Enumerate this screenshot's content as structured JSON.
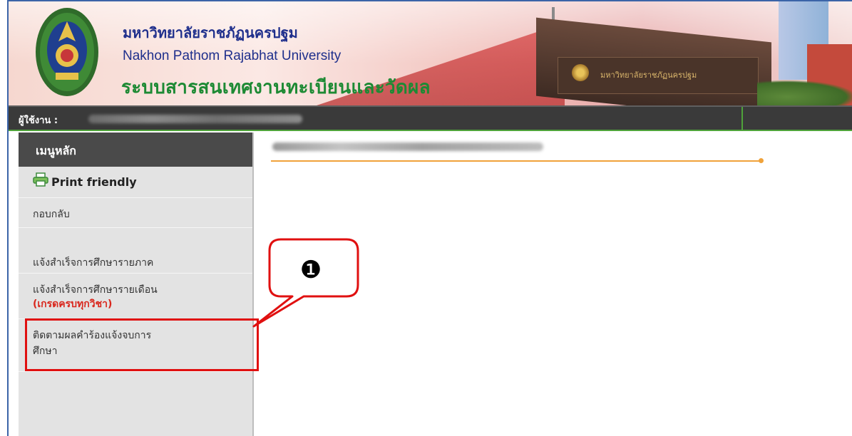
{
  "header": {
    "university_th": "มหาวิทยาลัยราชภัฏนครปฐม",
    "university_en": "Nakhon Pathom Rajabhat University",
    "system_title": "ระบบสารสนเทศงานทะเบียนและวัดผล",
    "building_sign": "มหาวิทยาลัยราชภัฏนครปฐม"
  },
  "userbar": {
    "label": "ผู้ใช้งาน :"
  },
  "sidebar": {
    "title": "เมนูหลัก",
    "items": [
      {
        "label": "Print friendly",
        "icon": "printer-icon"
      },
      {
        "label": "กอบกลับ"
      },
      {
        "label": "แจ้งสำเร็จการศึกษารายภาค"
      },
      {
        "label": "แจ้งสำเร็จการศึกษารายเดือน",
        "note": "(เกรดครบทุกวิชา)"
      },
      {
        "label_line1": "ติดตามผลคำร้องแจ้งจบการ",
        "label_line2": "ศึกษา"
      }
    ]
  },
  "annotation": {
    "step": "❶",
    "color": "#e01010"
  },
  "colors": {
    "userbar_bg": "#3a3a3a",
    "sidebar_bg": "#e3e3e3",
    "accent_green": "#1d8a34",
    "accent_orange": "#f0a23a"
  }
}
